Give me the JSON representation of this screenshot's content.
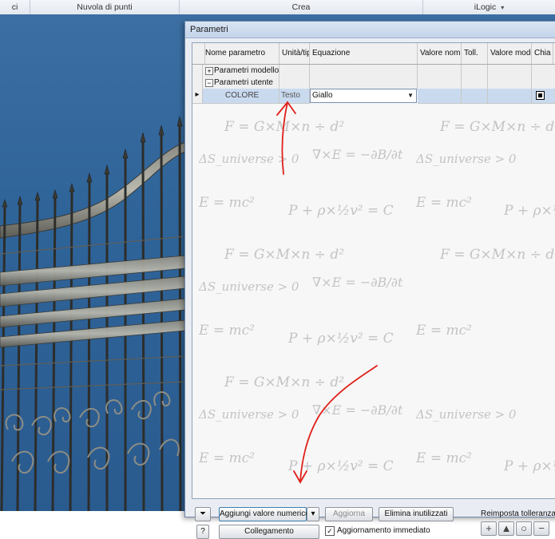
{
  "ribbon": {
    "groups": [
      "ci",
      "Nuvola di punti",
      "Crea",
      "iLogic"
    ],
    "ilogic_arrow": "▾"
  },
  "dialog": {
    "title": "Parametri",
    "columns": [
      "Nome parametro",
      "Unità/tip",
      "Equazione",
      "Valore nomin",
      "Toll.",
      "Valore model",
      "Chia"
    ],
    "groups": [
      {
        "expander": "+",
        "label": "Parametri modello"
      },
      {
        "expander": "−",
        "label": "Parametri utente"
      }
    ],
    "param_row": {
      "name": "COLORE",
      "unit": "Testo",
      "equation": "Giallo",
      "key_checked": true
    },
    "formulas": {
      "f1": "F = G×M×n ÷ d²",
      "f2": "∇×E = −∂B/∂t",
      "f3": "ΔS_universe > 0",
      "f4": "E = mc²",
      "f5": "P + ρ×½v² = C"
    }
  },
  "bottom": {
    "add_numeric": "Aggiungi valore numerico",
    "update": "Aggiorna",
    "purge": "Elimina inutilizzati",
    "reset_tolerance": "Reimposta tolleranza",
    "link": "Collegamento",
    "immediate_update": "Aggiornamento immediato",
    "immediate_checked": true,
    "help": "?"
  },
  "colors": {
    "viewport": "#2f6499",
    "annotation": "#e0201a",
    "selection": "#c9daef"
  }
}
